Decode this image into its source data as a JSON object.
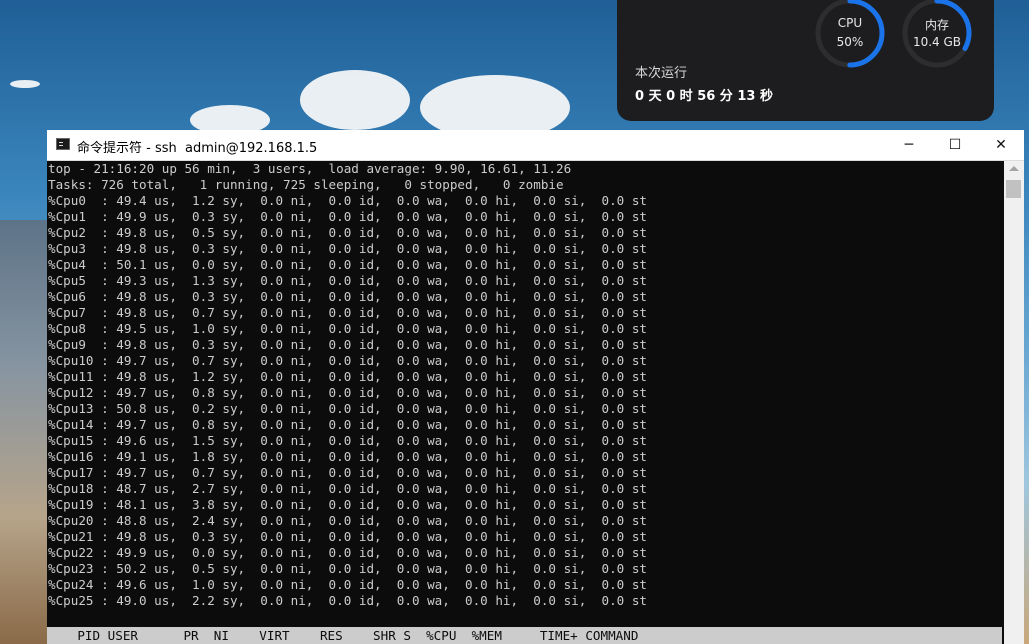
{
  "widget": {
    "cpu": {
      "label": "CPU",
      "value": "50%",
      "fraction": 0.5
    },
    "mem": {
      "label": "内存",
      "value": "10.4 GB",
      "fraction": 0.33
    },
    "uptime_title": "本次运行",
    "uptime_value": "0 天 0 时 56 分 13 秒",
    "accent": "#1a73e8"
  },
  "window": {
    "title": "命令提示符 - ssh  admin@192.168.1.5",
    "icon": "cmd-icon",
    "minimize": "─",
    "maximize": "☐",
    "close": "✕"
  },
  "terminal": {
    "lines": [
      "top - 21:16:20 up 56 min,  3 users,  load average: 9.90, 16.61, 11.26",
      "Tasks: 726 total,   1 running, 725 sleeping,   0 stopped,   0 zombie",
      "%Cpu0  : 49.4 us,  1.2 sy,  0.0 ni,  0.0 id,  0.0 wa,  0.0 hi,  0.0 si,  0.0 st",
      "%Cpu1  : 49.9 us,  0.3 sy,  0.0 ni,  0.0 id,  0.0 wa,  0.0 hi,  0.0 si,  0.0 st",
      "%Cpu2  : 49.8 us,  0.5 sy,  0.0 ni,  0.0 id,  0.0 wa,  0.0 hi,  0.0 si,  0.0 st",
      "%Cpu3  : 49.8 us,  0.3 sy,  0.0 ni,  0.0 id,  0.0 wa,  0.0 hi,  0.0 si,  0.0 st",
      "%Cpu4  : 50.1 us,  0.0 sy,  0.0 ni,  0.0 id,  0.0 wa,  0.0 hi,  0.0 si,  0.0 st",
      "%Cpu5  : 49.3 us,  1.3 sy,  0.0 ni,  0.0 id,  0.0 wa,  0.0 hi,  0.0 si,  0.0 st",
      "%Cpu6  : 49.8 us,  0.3 sy,  0.0 ni,  0.0 id,  0.0 wa,  0.0 hi,  0.0 si,  0.0 st",
      "%Cpu7  : 49.8 us,  0.7 sy,  0.0 ni,  0.0 id,  0.0 wa,  0.0 hi,  0.0 si,  0.0 st",
      "%Cpu8  : 49.5 us,  1.0 sy,  0.0 ni,  0.0 id,  0.0 wa,  0.0 hi,  0.0 si,  0.0 st",
      "%Cpu9  : 49.8 us,  0.3 sy,  0.0 ni,  0.0 id,  0.0 wa,  0.0 hi,  0.0 si,  0.0 st",
      "%Cpu10 : 49.7 us,  0.7 sy,  0.0 ni,  0.0 id,  0.0 wa,  0.0 hi,  0.0 si,  0.0 st",
      "%Cpu11 : 49.8 us,  1.2 sy,  0.0 ni,  0.0 id,  0.0 wa,  0.0 hi,  0.0 si,  0.0 st",
      "%Cpu12 : 49.7 us,  0.8 sy,  0.0 ni,  0.0 id,  0.0 wa,  0.0 hi,  0.0 si,  0.0 st",
      "%Cpu13 : 50.8 us,  0.2 sy,  0.0 ni,  0.0 id,  0.0 wa,  0.0 hi,  0.0 si,  0.0 st",
      "%Cpu14 : 49.7 us,  0.8 sy,  0.0 ni,  0.0 id,  0.0 wa,  0.0 hi,  0.0 si,  0.0 st",
      "%Cpu15 : 49.6 us,  1.5 sy,  0.0 ni,  0.0 id,  0.0 wa,  0.0 hi,  0.0 si,  0.0 st",
      "%Cpu16 : 49.1 us,  1.8 sy,  0.0 ni,  0.0 id,  0.0 wa,  0.0 hi,  0.0 si,  0.0 st",
      "%Cpu17 : 49.7 us,  0.7 sy,  0.0 ni,  0.0 id,  0.0 wa,  0.0 hi,  0.0 si,  0.0 st",
      "%Cpu18 : 48.7 us,  2.7 sy,  0.0 ni,  0.0 id,  0.0 wa,  0.0 hi,  0.0 si,  0.0 st",
      "%Cpu19 : 48.1 us,  3.8 sy,  0.0 ni,  0.0 id,  0.0 wa,  0.0 hi,  0.0 si,  0.0 st",
      "%Cpu20 : 48.8 us,  2.4 sy,  0.0 ni,  0.0 id,  0.0 wa,  0.0 hi,  0.0 si,  0.0 st",
      "%Cpu21 : 49.8 us,  0.3 sy,  0.0 ni,  0.0 id,  0.0 wa,  0.0 hi,  0.0 si,  0.0 st",
      "%Cpu22 : 49.9 us,  0.0 sy,  0.0 ni,  0.0 id,  0.0 wa,  0.0 hi,  0.0 si,  0.0 st",
      "%Cpu23 : 50.2 us,  0.5 sy,  0.0 ni,  0.0 id,  0.0 wa,  0.0 hi,  0.0 si,  0.0 st",
      "%Cpu24 : 49.6 us,  1.0 sy,  0.0 ni,  0.0 id,  0.0 wa,  0.0 hi,  0.0 si,  0.0 st",
      "%Cpu25 : 49.0 us,  2.2 sy,  0.0 ni,  0.0 id,  0.0 wa,  0.0 hi,  0.0 si,  0.0 st"
    ],
    "process_header": "    PID USER      PR  NI    VIRT    RES    SHR S  %CPU  %MEM     TIME+ COMMAND",
    "colors": {
      "background": "#0c0c0c",
      "text": "#cccccc",
      "header_bg": "#cccccc"
    }
  }
}
